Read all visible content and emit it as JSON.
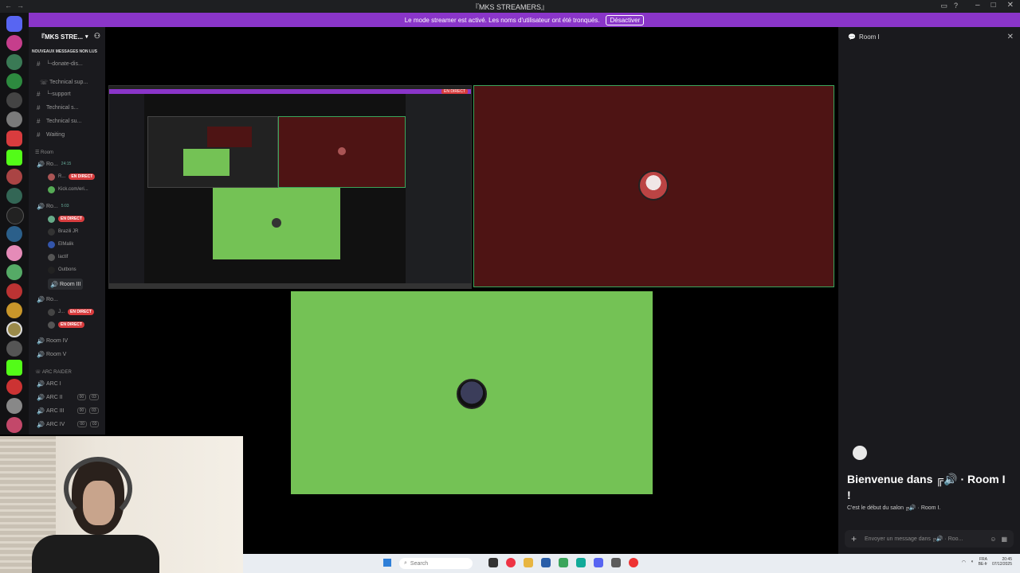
{
  "window": {
    "title": "『MKS STREAMERS』",
    "nav_glyphs": "←→"
  },
  "banner": {
    "text": "Le mode streamer est activé. Les noms d'utilisateur ont été tronqués.",
    "button": "Désactiver"
  },
  "server": {
    "name": "『MKS STRE...",
    "new_messages": "NOUVEAUX MESSAGES NON LUS"
  },
  "channels": [
    {
      "label": "└-donate-dis...",
      "kind": "text"
    },
    {
      "label": "Technical sup...",
      "kind": "voice-cat"
    },
    {
      "label": "└-support",
      "kind": "text"
    },
    {
      "label": "Technical s...",
      "kind": "text"
    },
    {
      "label": "Technical su...",
      "kind": "text"
    },
    {
      "label": "Waiting",
      "kind": "text"
    }
  ],
  "room_category": "Room",
  "rooms": [
    {
      "label": "Ro...",
      "timer": "24:15"
    },
    {
      "label": "Ro...",
      "timer": "5:03"
    },
    {
      "label": "Room III",
      "timer": ""
    },
    {
      "label": "Ro...",
      "timer": ""
    },
    {
      "label": "Room IV",
      "timer": ""
    },
    {
      "label": "Room V",
      "timer": ""
    }
  ],
  "room_users": [
    {
      "name": "R...",
      "live": "EN DIRECT"
    },
    {
      "name": "Kick.com/eri...",
      "live": ""
    },
    {
      "name": "",
      "live": "EN DIRECT"
    },
    {
      "name": "Brazili JR",
      "live": ""
    },
    {
      "name": "ElMalik",
      "live": ""
    },
    {
      "name": "lactif",
      "live": ""
    },
    {
      "name": "Outbons",
      "live": ""
    },
    {
      "name": "J...",
      "live": "EN DIRECT"
    },
    {
      "name": "",
      "live": "EN DIRECT"
    }
  ],
  "arc_category": "ARC RAIDER",
  "arc_channels": [
    {
      "label": "ARC I",
      "badge1": "",
      "badge2": ""
    },
    {
      "label": "ARC II",
      "badge1": "00",
      "badge2": "03"
    },
    {
      "label": "ARC III",
      "badge1": "00",
      "badge2": "03"
    },
    {
      "label": "ARC IV",
      "badge1": "00",
      "badge2": "03"
    }
  ],
  "mini_screen": {
    "live_badge": "EN DIRECT"
  },
  "right_panel": {
    "header": "Room I",
    "welcome": "Bienvenue dans ╔🔊 · Room I !",
    "subtext": "C'est le début du salon ╔🔊 · Room I.",
    "input_placeholder": "Envoyer un message dans ╔🔊 · Roo..."
  },
  "taskbar": {
    "search_placeholder": "Search",
    "lang": "FRA",
    "lang2": "BE-fr",
    "time": "20:45",
    "date": "07/12/2025"
  },
  "colors": {
    "accent": "#8a35c9",
    "live": "#d83c3e",
    "green_tile": "#74c255",
    "red_tile": "#4e1414",
    "speaking": "#3ba55c"
  }
}
